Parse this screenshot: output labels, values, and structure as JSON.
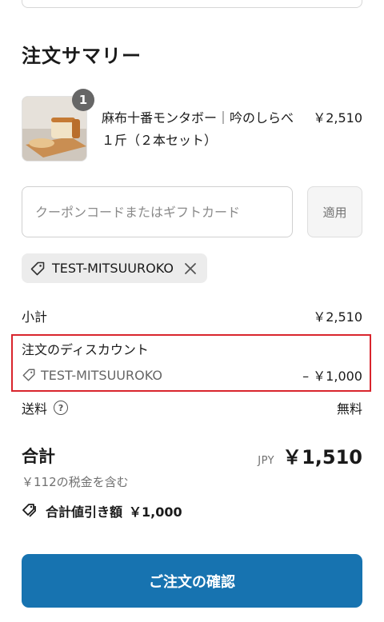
{
  "summary": {
    "title": "注文サマリー"
  },
  "product": {
    "quantity": "1",
    "name": "麻布十番モンタボー｜吟のしらべ　１斤（２本セット）",
    "price": "￥2,510"
  },
  "coupon": {
    "placeholder": "クーポンコードまたはギフトカード",
    "apply_label": "適用",
    "applied_code": "TEST-MITSUUROKO"
  },
  "totals": {
    "subtotal_label": "小計",
    "subtotal_value": "￥2,510",
    "discount_label": "注文のディスカウント",
    "discount_code": "TEST-MITSUUROKO",
    "discount_value": "– ￥1,000",
    "shipping_label": "送料",
    "shipping_value": "無料",
    "total_label": "合計",
    "currency": "JPY",
    "total_value": "￥1,510",
    "tax_note": "￥112の税金を含む",
    "savings_label": "合計値引き額",
    "savings_value": "￥1,000"
  },
  "actions": {
    "confirm_label": "ご注文の確認"
  },
  "colors": {
    "primary_button": "#1773b0",
    "highlight_border": "#d9252d"
  },
  "icons": [
    "tag-icon",
    "close-icon",
    "help-circle-icon",
    "tags-icon"
  ]
}
